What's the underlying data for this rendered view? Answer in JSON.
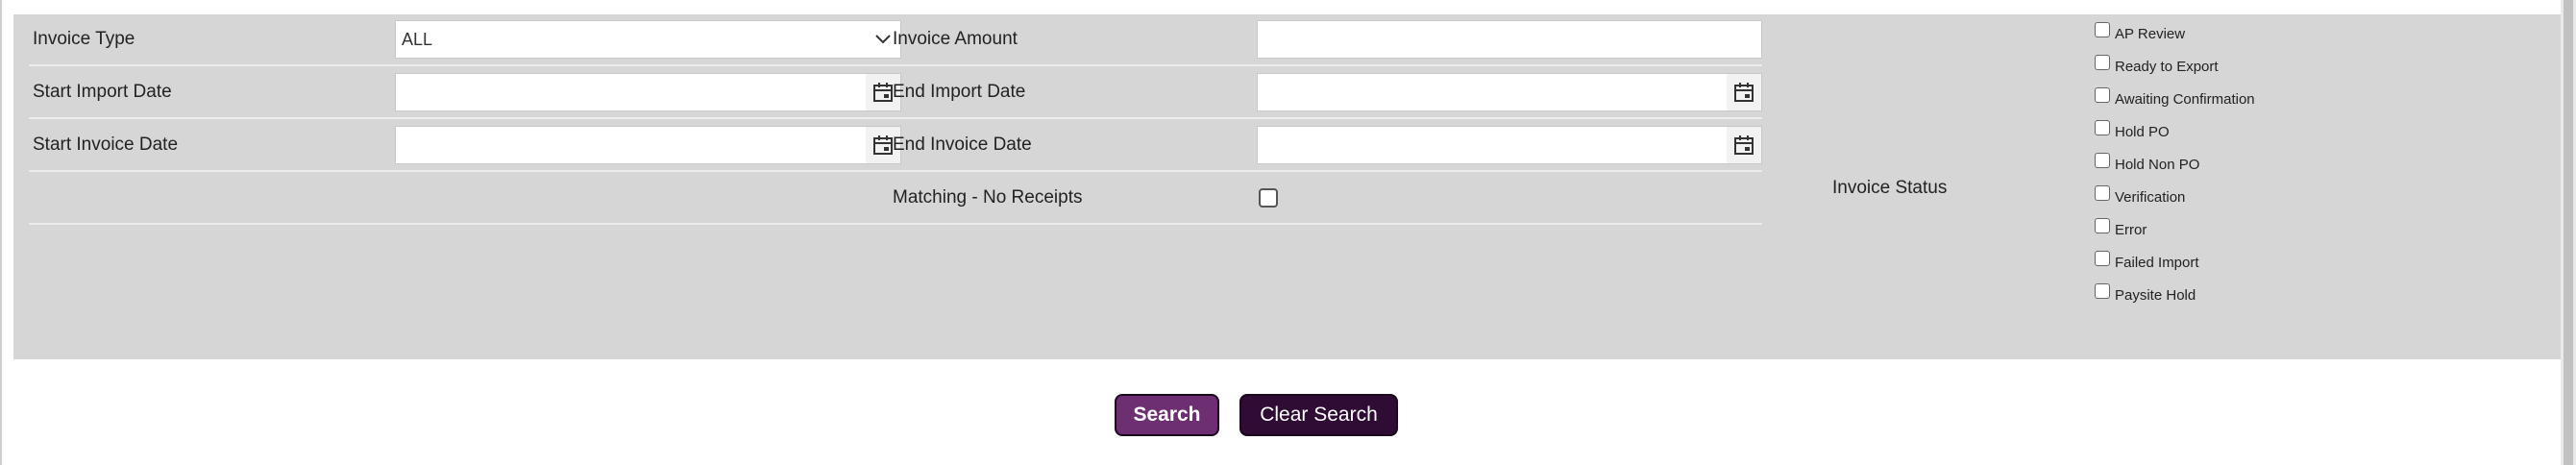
{
  "form": {
    "invoice_type": {
      "label": "Invoice Type",
      "value": "ALL"
    },
    "invoice_amount": {
      "label": "Invoice Amount",
      "value": ""
    },
    "start_import_date": {
      "label": "Start Import Date",
      "value": ""
    },
    "end_import_date": {
      "label": "End Import Date",
      "value": ""
    },
    "start_invoice_date": {
      "label": "Start Invoice Date",
      "value": ""
    },
    "end_invoice_date": {
      "label": "End Invoice Date",
      "value": ""
    },
    "matching_no_receipts": {
      "label": "Matching - No Receipts",
      "checked": false
    }
  },
  "invoice_status": {
    "label": "Invoice Status",
    "options": [
      {
        "label": "AP Review",
        "checked": false
      },
      {
        "label": "Ready to Export",
        "checked": false
      },
      {
        "label": "Awaiting Confirmation",
        "checked": false
      },
      {
        "label": "Hold PO",
        "checked": false
      },
      {
        "label": "Hold Non PO",
        "checked": false
      },
      {
        "label": "Verification",
        "checked": false
      },
      {
        "label": "Error",
        "checked": false
      },
      {
        "label": "Failed Import",
        "checked": false
      },
      {
        "label": "Paysite Hold",
        "checked": false
      }
    ]
  },
  "buttons": {
    "search": "Search",
    "clear_search": "Clear Search"
  },
  "colors": {
    "panel_bg": "#d6d6d6",
    "search_btn": "#6e2f72",
    "clear_btn": "#2e0c33"
  },
  "icons": {
    "dropdown": "chevron-down-icon",
    "date": "calendar-icon"
  }
}
